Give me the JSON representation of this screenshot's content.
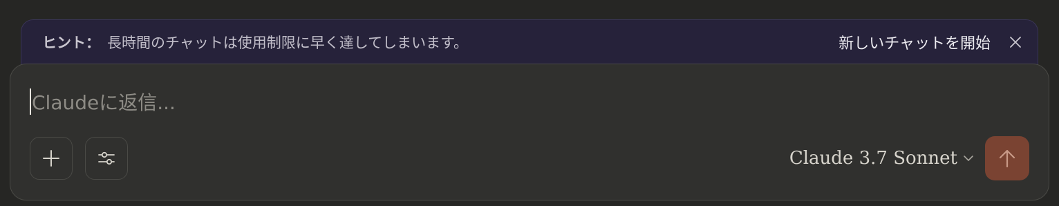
{
  "hint": {
    "label": "ヒント：",
    "text": "長時間のチャットは使用制限に早く達してしまいます。",
    "action_label": "新しいチャットを開始",
    "close_icon": "close-icon"
  },
  "composer": {
    "placeholder": "Claudeに返信...",
    "value": "",
    "add_icon": "plus-icon",
    "options_icon": "sliders-icon",
    "model_label": "Claude 3.7 Sonnet",
    "model_chevron_icon": "chevron-down-icon",
    "send_icon": "arrow-up-icon"
  },
  "colors": {
    "background": "#262624",
    "banner": "#26223a",
    "composer": "#30302e",
    "send_button": "#7a4332"
  }
}
